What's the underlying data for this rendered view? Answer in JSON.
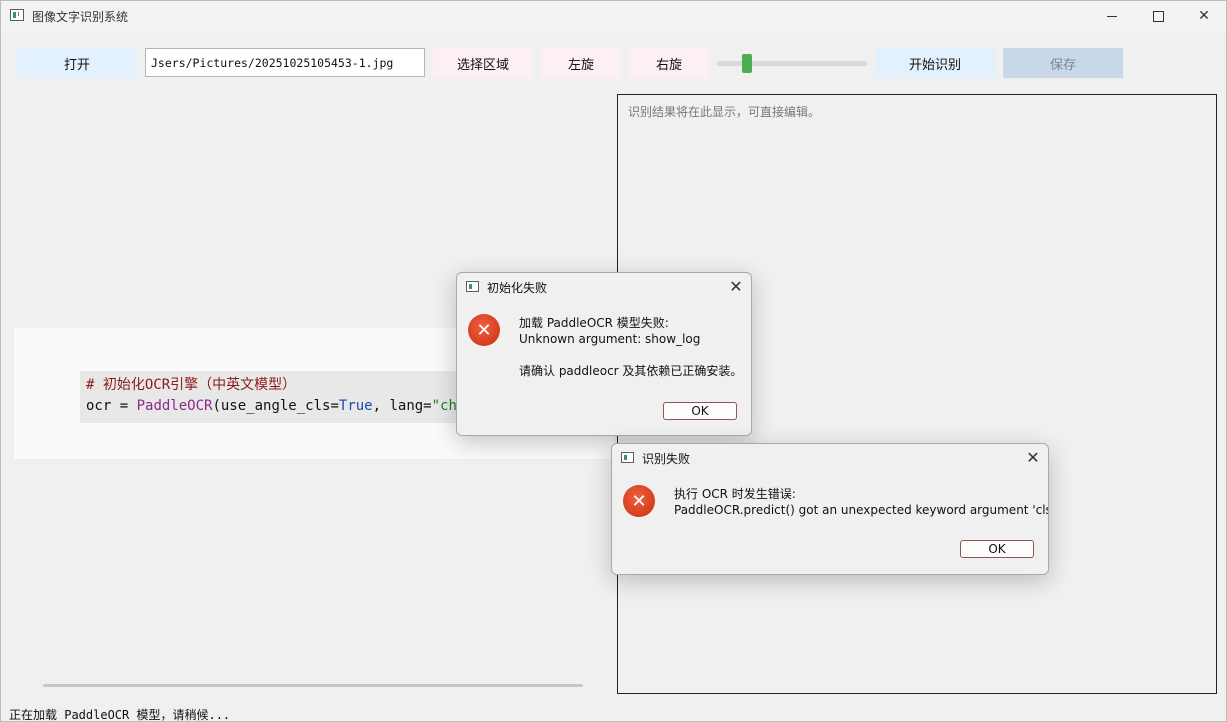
{
  "window": {
    "title": "图像文字识别系统"
  },
  "toolbar": {
    "open_label": "打开",
    "path_value": "Jsers/Pictures/20251025105453-1.jpg",
    "select_region_label": "选择区域",
    "rotate_left_label": "左旋",
    "rotate_right_label": "右旋",
    "start_ocr_label": "开始识别",
    "save_label": "保存",
    "zoom_slider_fraction": 0.2
  },
  "image_preview": {
    "code_line1": "# 初始化OCR引擎（中英文模型）",
    "code_line2_parts": [
      "ocr",
      " = ",
      "PaddleOCR",
      "(use_angle_cls=",
      "True",
      ", lang=",
      "\"ch\""
    ]
  },
  "result_panel": {
    "placeholder": "识别结果将在此显示，可直接编辑。"
  },
  "status_bar": {
    "text": "正在加载 PaddleOCR 模型，请稍候..."
  },
  "dialog_init": {
    "title": "初始化失败",
    "line1": "加载 PaddleOCR 模型失败:",
    "line2": "Unknown argument: show_log",
    "line3": "请确认 paddleocr 及其依赖已正确安装。",
    "ok_label": "OK"
  },
  "dialog_recognize": {
    "title": "识别失败",
    "line1": "执行 OCR 时发生错误:",
    "line2": "PaddleOCR.predict() got an unexpected keyword argument 'cls'",
    "ok_label": "OK"
  },
  "colors": {
    "accent_blue": "#e3f0fd",
    "accent_pink": "#fcf0f3",
    "slider_handle": "#4cae50",
    "error_icon": "#d8401e"
  },
  "icons": {
    "app": "app-window-icon",
    "error": "error-circle-x-icon",
    "close": "close-icon"
  }
}
